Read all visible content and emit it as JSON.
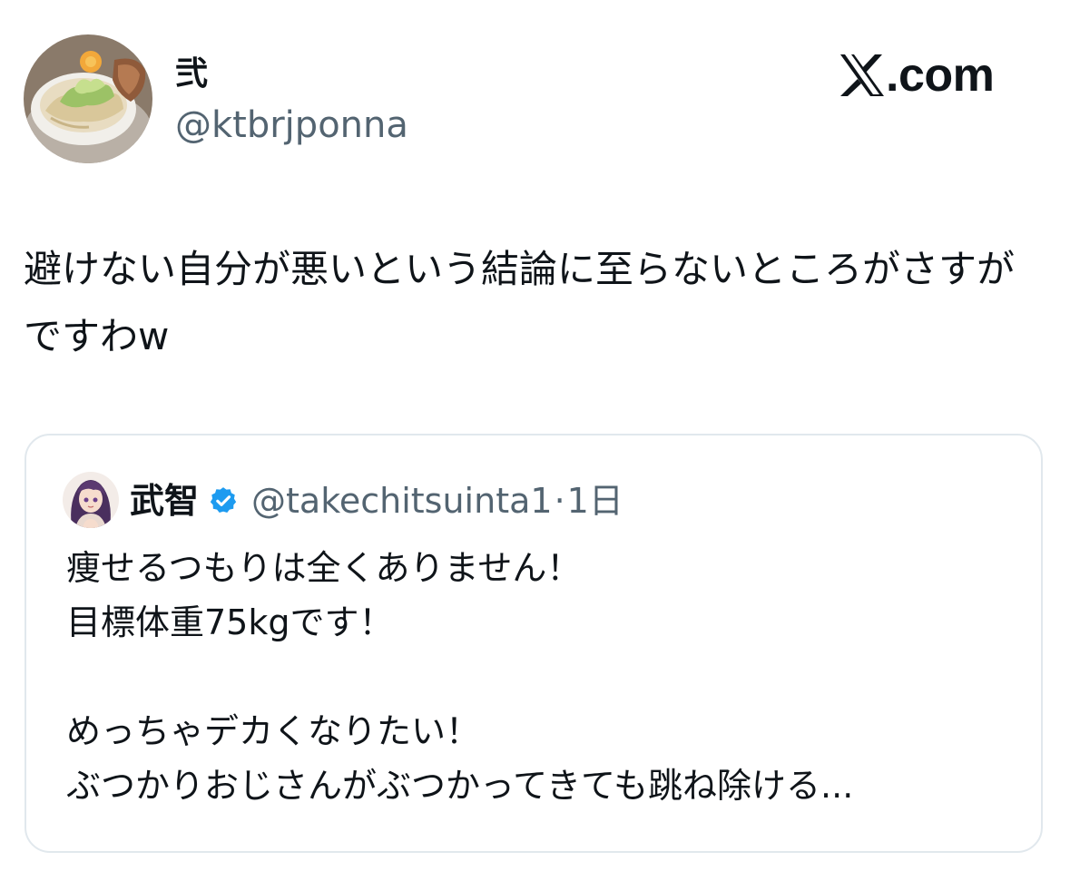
{
  "app": {
    "brand_text": ".com"
  },
  "tweet": {
    "author": {
      "display_name": "弐",
      "handle": "@ktbrjponna",
      "avatar_icon": "ramen-bowl-avatar"
    },
    "text": "避けない自分が悪いという結論に至らないところがさすがですわw"
  },
  "quoted_tweet": {
    "author": {
      "display_name": "武智",
      "handle": "@takechitsuinta1",
      "verified": true,
      "verified_color": "#1d9bf0",
      "avatar_icon": "anime-girl-avatar"
    },
    "separator": "·",
    "time": "1日",
    "text": "痩せるつもりは全くありません！\n目標体重75kgです！\n\nめっちゃデカくなりたい！\nぶつかりおじさんがぶつかってきても跳ね除ける..."
  },
  "colors": {
    "text_primary": "#0f1419",
    "text_secondary": "#536471",
    "card_border": "#e1e8ed"
  }
}
